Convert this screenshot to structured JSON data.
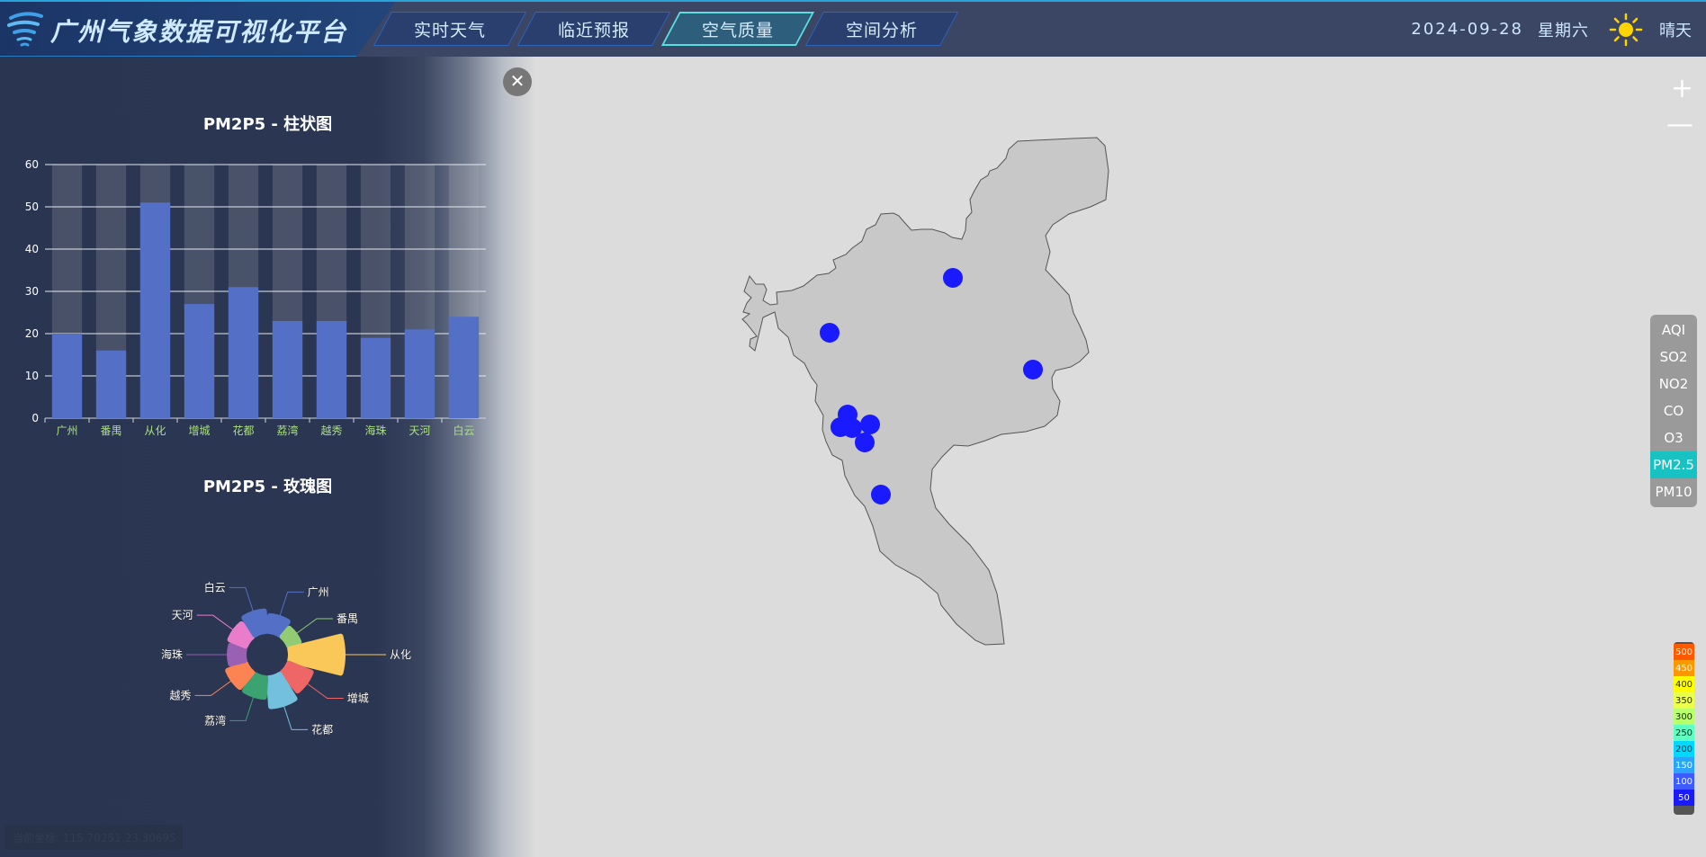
{
  "header": {
    "title": "广州气象数据可视化平台",
    "tabs": [
      {
        "label": "实时天气",
        "active": false
      },
      {
        "label": "临近预报",
        "active": false
      },
      {
        "label": "空气质量",
        "active": true
      },
      {
        "label": "空间分析",
        "active": false
      }
    ],
    "date": "2024-09-28",
    "weekday": "星期六",
    "weather_icon": "sun-icon",
    "weather": "晴天"
  },
  "left_panel": {
    "close_icon": "close-icon",
    "bar_title": "PM2P5 - 柱状图",
    "rose_title": "PM2P5 - 玫瑰图"
  },
  "chart_data": [
    {
      "type": "bar",
      "title": "PM2P5 - 柱状图",
      "categories": [
        "广州",
        "番禺",
        "从化",
        "增城",
        "花都",
        "荔湾",
        "越秀",
        "海珠",
        "天河",
        "白云"
      ],
      "values": [
        20,
        16,
        51,
        27,
        31,
        23,
        23,
        19,
        21,
        24
      ],
      "ylim": [
        0,
        60
      ],
      "yticks": [
        0,
        10,
        20,
        30,
        40,
        50,
        60
      ],
      "grid": true,
      "bar_color": "#5470c6"
    },
    {
      "type": "pie",
      "variant": "rose",
      "title": "PM2P5 - 玫瑰图",
      "categories": [
        "广州",
        "番禺",
        "从化",
        "增城",
        "花都",
        "荔湾",
        "越秀",
        "海珠",
        "天河",
        "白云"
      ],
      "values": [
        20,
        16,
        51,
        27,
        31,
        23,
        23,
        19,
        21,
        24
      ],
      "colors": [
        "#5470c6",
        "#91cc75",
        "#fac858",
        "#ee6666",
        "#73c0de",
        "#3ba272",
        "#fc8452",
        "#9a60b4",
        "#ea7ccc",
        "#5470c6"
      ]
    }
  ],
  "map": {
    "stations": 10,
    "station_color": "#1a1aff",
    "zoom_in": "+",
    "zoom_out": "—"
  },
  "pollutants": {
    "items": [
      "AQI",
      "SO2",
      "NO2",
      "CO",
      "O3",
      "PM2.5",
      "PM10"
    ],
    "active": "PM2.5"
  },
  "legend": {
    "levels": [
      "500",
      "450",
      "400",
      "350",
      "300",
      "250",
      "200",
      "150",
      "100",
      "50"
    ],
    "colors": [
      "#ff5a00",
      "#ff9800",
      "#ffff00",
      "#ecff4a",
      "#b8ff6e",
      "#5effc0",
      "#00d8ff",
      "#2aa4ff",
      "#3c5cff",
      "#1a1aff"
    ]
  },
  "status": {
    "coord_label": "当前坐标: 115.70251,23.30695"
  }
}
